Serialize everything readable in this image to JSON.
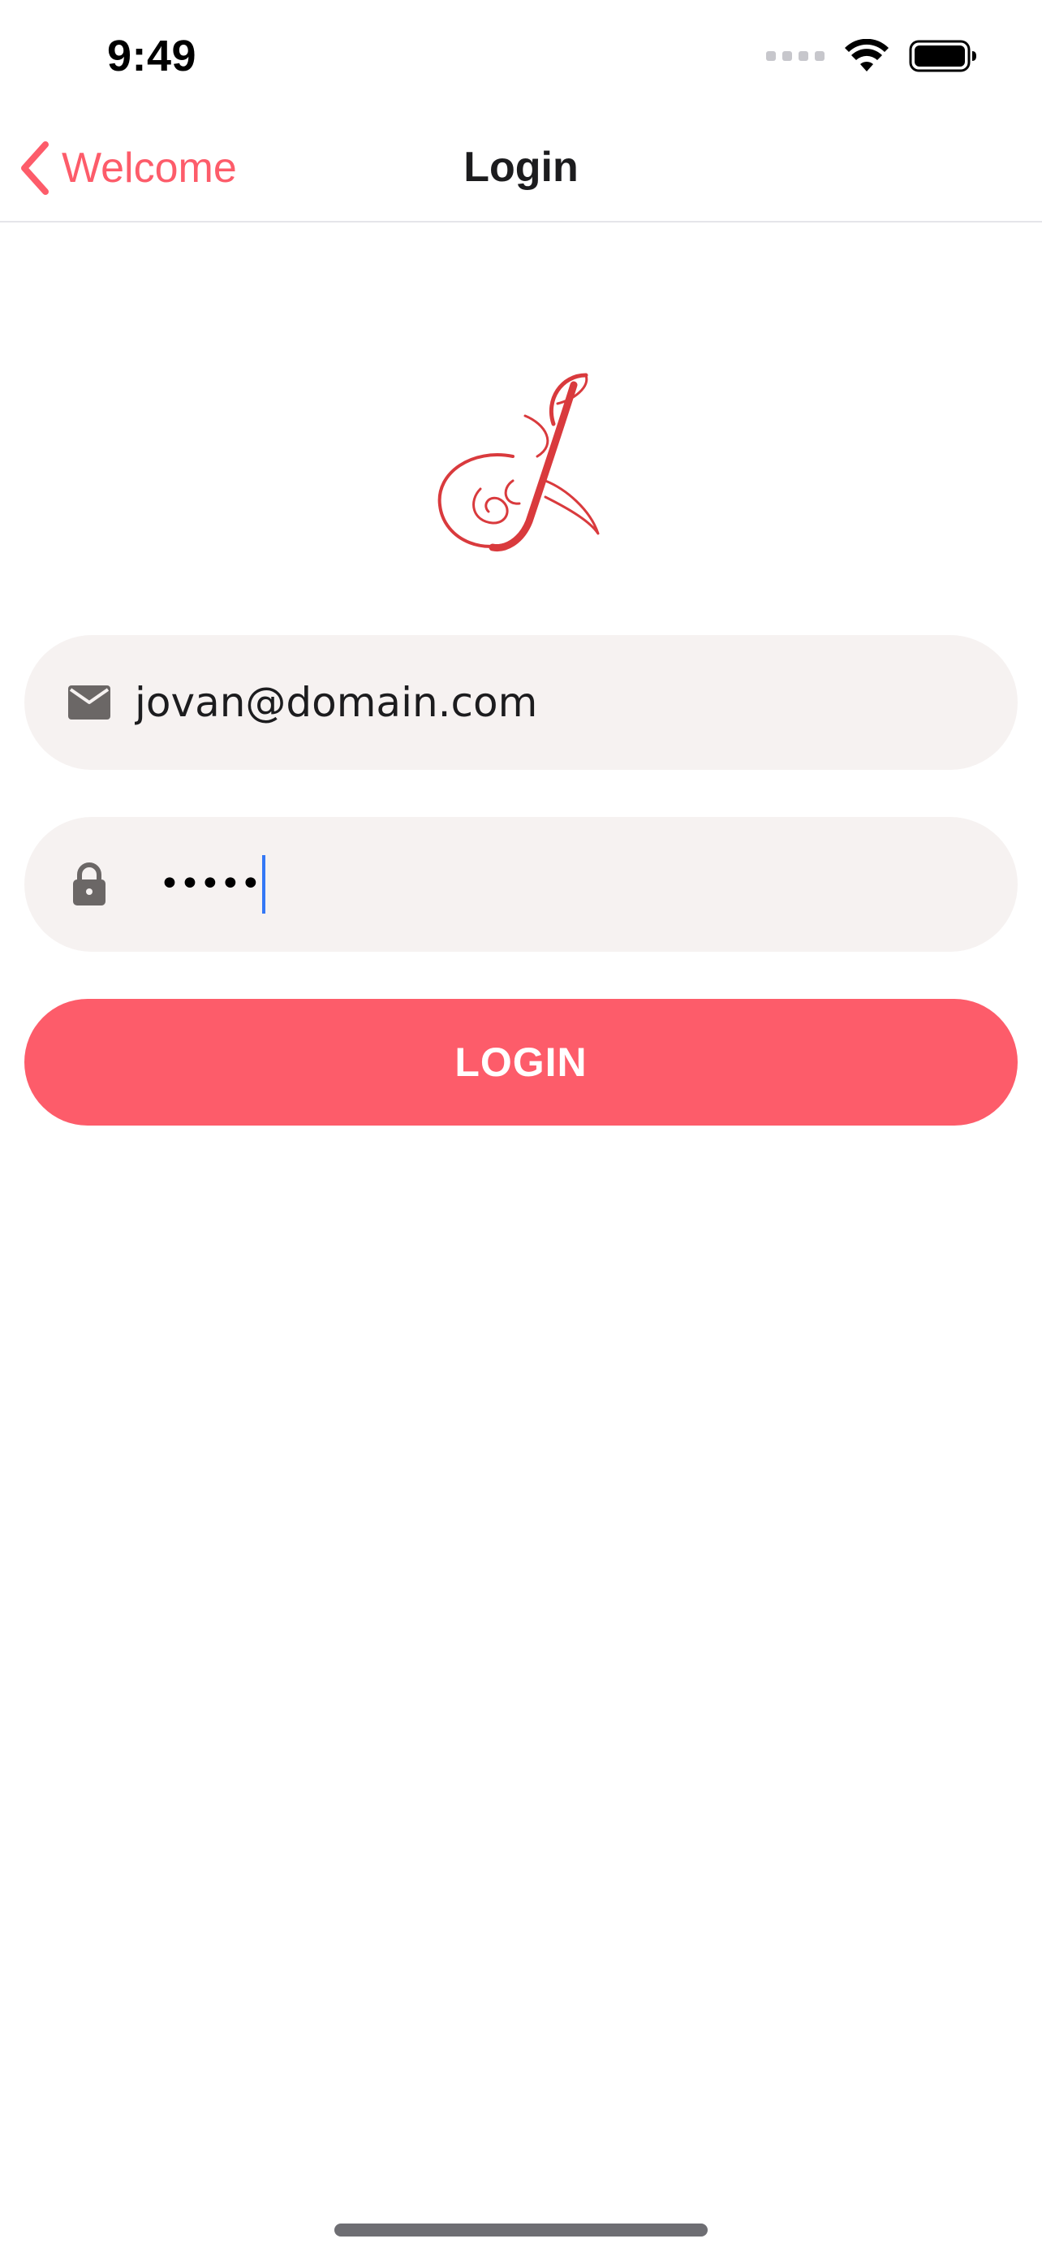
{
  "status_bar": {
    "time": "9:49"
  },
  "nav": {
    "back_label": "Welcome",
    "title": "Login"
  },
  "logo": {
    "monogram": "J",
    "color": "#d93a3d"
  },
  "form": {
    "email": {
      "value": "jovan@domain.com",
      "icon": "mail-icon"
    },
    "password": {
      "masked_value": "•••••",
      "icon": "lock-icon"
    },
    "login_button_label": "LOGIN"
  },
  "colors": {
    "accent": "#fd5c6a",
    "field_background": "#f6f2f1",
    "caret": "#3478f6",
    "icon": "#6b6766"
  }
}
